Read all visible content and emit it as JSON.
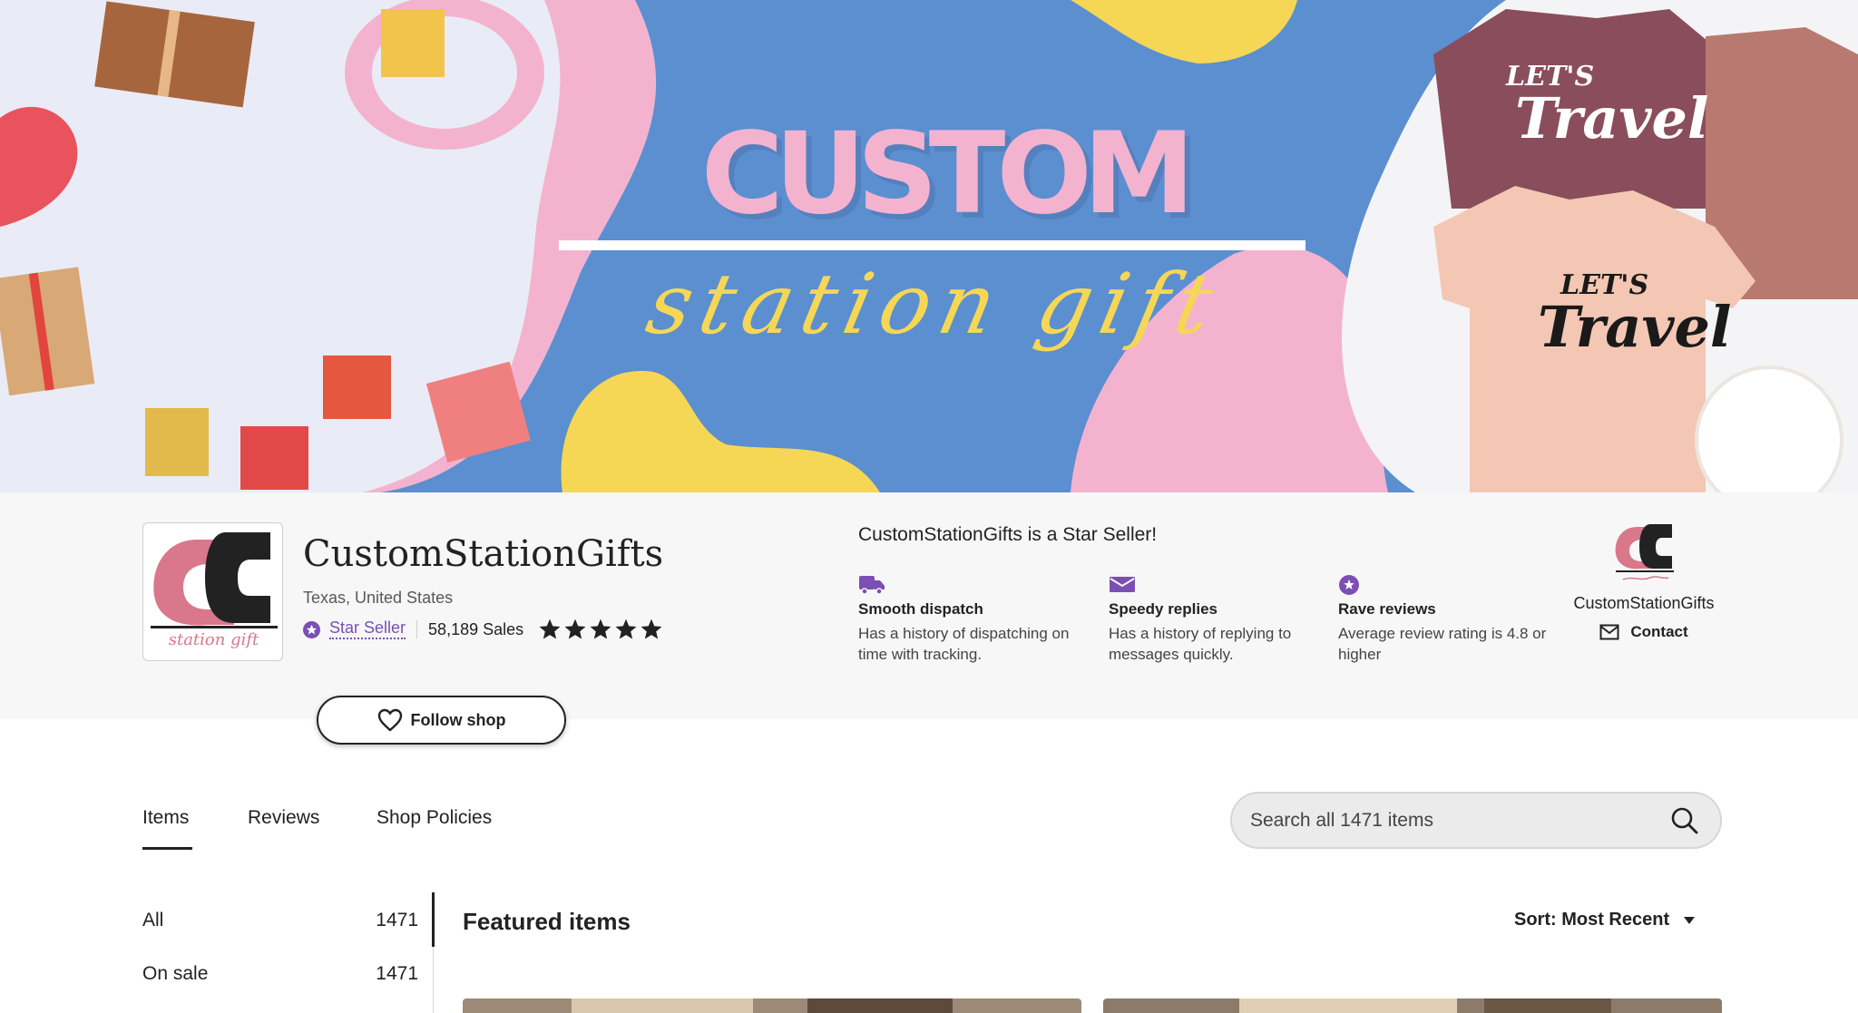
{
  "banner": {
    "title": "CUSTOM",
    "subtitle": "station gift",
    "tee_text_line1": "LET'S",
    "tee_text_line2": "Travel",
    "colors": {
      "background": "#5b8fd0",
      "pink": "#f3b3cf",
      "yellow": "#f6d755"
    }
  },
  "shop": {
    "name": "CustomStationGifts",
    "location": "Texas, United States",
    "star_seller_label": "Star Seller",
    "sales": "58,189 Sales",
    "rating_stars": 5,
    "follow_label": "Follow shop",
    "logo_script": "station gift"
  },
  "star_seller": {
    "heading": "CustomStationGifts is a Star Seller!",
    "perks": [
      {
        "icon": "truck-icon",
        "title": "Smooth dispatch",
        "desc": "Has a history of dispatching on time with tracking."
      },
      {
        "icon": "mail-icon",
        "title": "Speedy replies",
        "desc": "Has a history of replying to messages quickly."
      },
      {
        "icon": "star-badge-icon",
        "title": "Rave reviews",
        "desc": "Average review rating is 4.8 or higher"
      }
    ]
  },
  "owner": {
    "name": "CustomStationGifts",
    "contact_label": "Contact"
  },
  "tabs": [
    {
      "label": "Items",
      "active": true
    },
    {
      "label": "Reviews",
      "active": false
    },
    {
      "label": "Shop Policies",
      "active": false
    }
  ],
  "search": {
    "placeholder": "Search all 1471 items"
  },
  "sidebar": {
    "categories": [
      {
        "label": "All",
        "count": "1471",
        "active": true
      },
      {
        "label": "On sale",
        "count": "1471",
        "active": false
      }
    ]
  },
  "featured": {
    "title": "Featured items",
    "sort_label": "Sort: Most Recent"
  },
  "colors": {
    "accent_purple": "#7b4fb3",
    "text": "#222222",
    "header_bg": "#f7f7f7"
  }
}
